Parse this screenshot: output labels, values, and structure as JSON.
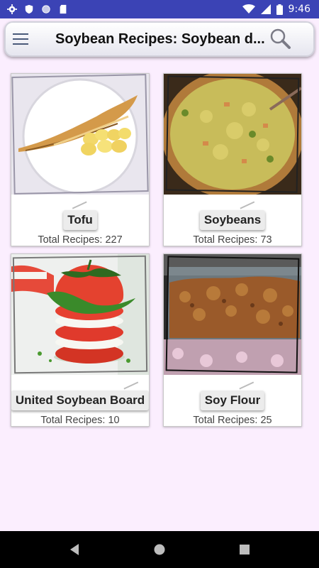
{
  "status_bar": {
    "time": "9:46",
    "icons_left": [
      "gear-icon",
      "shield-icon",
      "circle-icon",
      "sdcard-icon"
    ],
    "icons_right": [
      "wifi-icon",
      "signal-icon",
      "battery-icon"
    ]
  },
  "app_bar": {
    "title": "Soybean Recipes: Soybean d...",
    "menu_icon": "hamburger-menu-icon",
    "search_icon": "search-icon"
  },
  "categories": [
    {
      "name": "Tofu",
      "count_text": "Total Recipes: 227",
      "image": "soybean-pods-image"
    },
    {
      "name": "Soybeans",
      "count_text": "Total Recipes: 73",
      "image": "soybean-soup-image"
    },
    {
      "name": "United Soybean Board",
      "count_text": "Total Recipes: 10",
      "image": "tomato-stack-image"
    },
    {
      "name": "Soy Flour",
      "count_text": "Total Recipes: 25",
      "image": "soy-flour-bread-image"
    }
  ],
  "nav_bar": {
    "back_icon": "back-triangle-icon",
    "home_icon": "home-circle-icon",
    "recents_icon": "recents-square-icon"
  }
}
